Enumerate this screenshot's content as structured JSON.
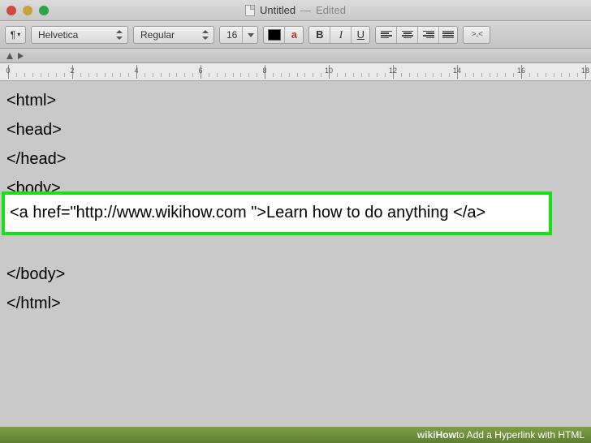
{
  "window": {
    "title": "Untitled",
    "status": "Edited"
  },
  "toolbar": {
    "style_label": "¶",
    "font": "Helvetica",
    "weight": "Regular",
    "size": "16",
    "text_a": "a",
    "bold": "B",
    "italic": "I",
    "underline": "U",
    "overflow": ">..<"
  },
  "ruler": {
    "labels": [
      "0",
      "2",
      "4",
      "6",
      "8",
      "10",
      "12",
      "14",
      "16",
      "18"
    ]
  },
  "document": {
    "lines": [
      "<html>",
      "<head>",
      "</head>",
      "<body>",
      "<a href=\"http://www.wikihow.com \">Learn how to do anything </a>",
      "</body>",
      "</html>"
    ]
  },
  "caption": {
    "brand_prefix": "wiki",
    "brand_suffix": "How",
    "text": " to Add a Hyperlink with HTML"
  }
}
